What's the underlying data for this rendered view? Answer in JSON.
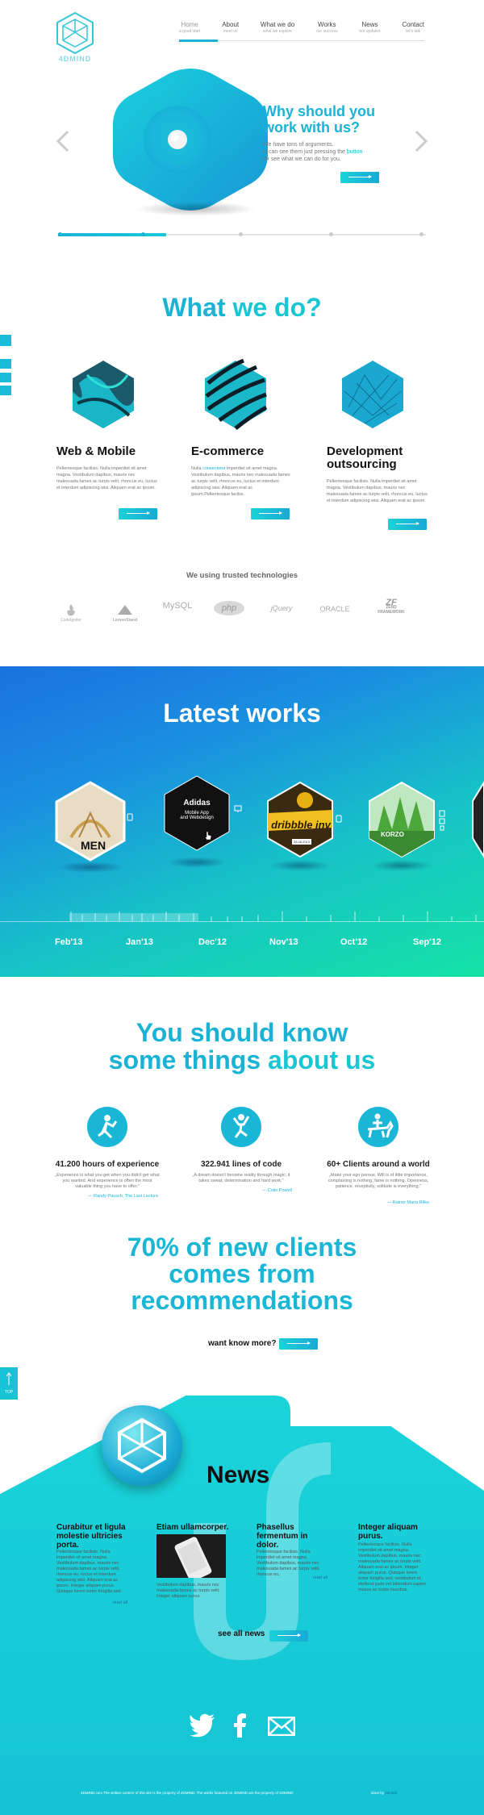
{
  "header": {
    "logo_text": "4DMIND",
    "nav": [
      {
        "label": "Home",
        "sub": "a good start"
      },
      {
        "label": "About",
        "sub": "meet us"
      },
      {
        "label": "What we do",
        "sub": "what we explore"
      },
      {
        "label": "Works",
        "sub": "our success"
      },
      {
        "label": "News",
        "sub": "hot updates"
      },
      {
        "label": "Contact",
        "sub": "let's talk"
      }
    ]
  },
  "hero": {
    "title": "Why should you work with us?",
    "line1": "We have tons of arguments.",
    "line2_a": "U can see them just pressing the ",
    "line2_link": "button",
    "line3": "Or see what we can do for you."
  },
  "what_we_do": {
    "title_a": "What ",
    "title_b": "we do?",
    "services": [
      {
        "title": "Web & Mobile",
        "text": "Pellentesque facilisis. Nulla imperdiet sit amet magna. Vestibulum dapibus, mauris nec malesuada fames ac turpis velit, rhoncus eu, luctus et interdum adipiscing wisi. Aliquam erat ac ipsum."
      },
      {
        "title": "E-commerce",
        "text_a": "Nulla ",
        "text_link": "consectetur",
        "text_b": " imperdiet sit amet magna. Vestibulum dapibus, mauris nec malesuada fames ac turpis velit, rhoncus eu, luctus et interdum adipiscing wisi. Aliquam erat ac ipsum.Pellentesque facilisi."
      },
      {
        "title": "Development outsourcing",
        "text": "Pellentesque facilisis. Nulla imperdiet sit amet magna. Vestibulum dapibus, mauris nec malesuada fames ac turpis velit, rhoncus eu, luctus et interdum adipiscing wisi. Aliquam erat ac ipsum."
      }
    ],
    "tech_title": "We using trusted technologies",
    "tech": [
      "CodeIgniter",
      "LemonStand",
      "MySQL",
      "php",
      "jQuery",
      "ORACLE",
      "ZEND FRAMEWORK"
    ]
  },
  "works": {
    "title": "Latest works",
    "featured": {
      "title": "Adidas",
      "line1": "Mobile App",
      "line2": "and Webdesign"
    },
    "items": [
      "MEN",
      "dribbble inv",
      "KORZO"
    ],
    "badge": "26.08.2013",
    "dates": [
      "Feb'13",
      "Jan'13",
      "Dec'12",
      "Nov'13",
      "Oct'12",
      "Sep'12"
    ]
  },
  "know": {
    "title_a": "You should know",
    "title_b_a": "some things ",
    "title_b_b": "about us",
    "stats": [
      {
        "title": "41.200 hours of experience",
        "quote": "„Experience is what you get when you didn't get what you wanted. And experience is often the most valuable thing you have to offer.\"",
        "author": "— Randy Pausch, The Last Lecture"
      },
      {
        "title": "322.941 lines of code",
        "quote": "„A dream doesn't become reality through magic; it takes sweat, determination and hard work.\"",
        "author": "— Colin Powell"
      },
      {
        "title": "60+ Clients around a world",
        "quote": "„Make your ego porous. Will is of little importance, complaining is nothing, fame is nothing. Openness, patience, receptivity, solitude is everything.\"",
        "author": "— Rainer Maria Rilke"
      }
    ]
  },
  "recommend": {
    "line1": "70% of new clients",
    "line2": "comes from",
    "line3": "recommendations",
    "cta": "want know more?"
  },
  "top_button": "TOP",
  "news": {
    "title": "News",
    "items": [
      {
        "title": "Curabitur et ligula molestie ultricies porta.",
        "text": "Pellentesque facilisis. Nulla imperdiet sit amet magna. Vestibulum dapibus, mauris nec malesuada fames ac turpis velit, rhoncus eu, luctus et interdum adipiscing wisi. Aliquam erat ac ipsum. Integer aliquam purus. Quisque lorem tortor fringilla sed.",
        "read": "read all"
      },
      {
        "title": "Etiam ullamcorper.",
        "text": "Vestibulum dapibus, mauris nec malesuada fames ac turpis velit. Integer aliquam purus.",
        "read": ""
      },
      {
        "title": "Phasellus fermentum in dolor.",
        "text": "Pellentesque facilisis. Nulla imperdiet sit amet magna. Vestibulum dapibus, mauris nec malesuada fames ac turpis velit, rhoncus eu.",
        "read": "read all"
      },
      {
        "title": "Integer aliquam purus.",
        "text": "Pellentesque facilisis. Nulla imperdiet sit amet magna. Vestibulum dapibus, mauris nec malesuada fames ac turpis velit. Aliquam erat ac ipsum. Integer aliquam purus. Quisque lorem tortor fringilla sed, vestibulum id, eleifend justo vel bibendum sapien massa ac turpis faucibus.",
        "read": ""
      }
    ],
    "see_all": "see all news"
  },
  "footer": {
    "text": "4DMIND.com  The written content of this site is the property of 4DMIND. The works featured on 4DMIND are the property of 4DMIND",
    "by_a": "done by ",
    "by_b": "4dmind"
  },
  "colors": {
    "accent": "#1ab3d6",
    "teal": "#19c6d4",
    "works_start": "#1a72df",
    "works_end": "#15e3a6"
  }
}
